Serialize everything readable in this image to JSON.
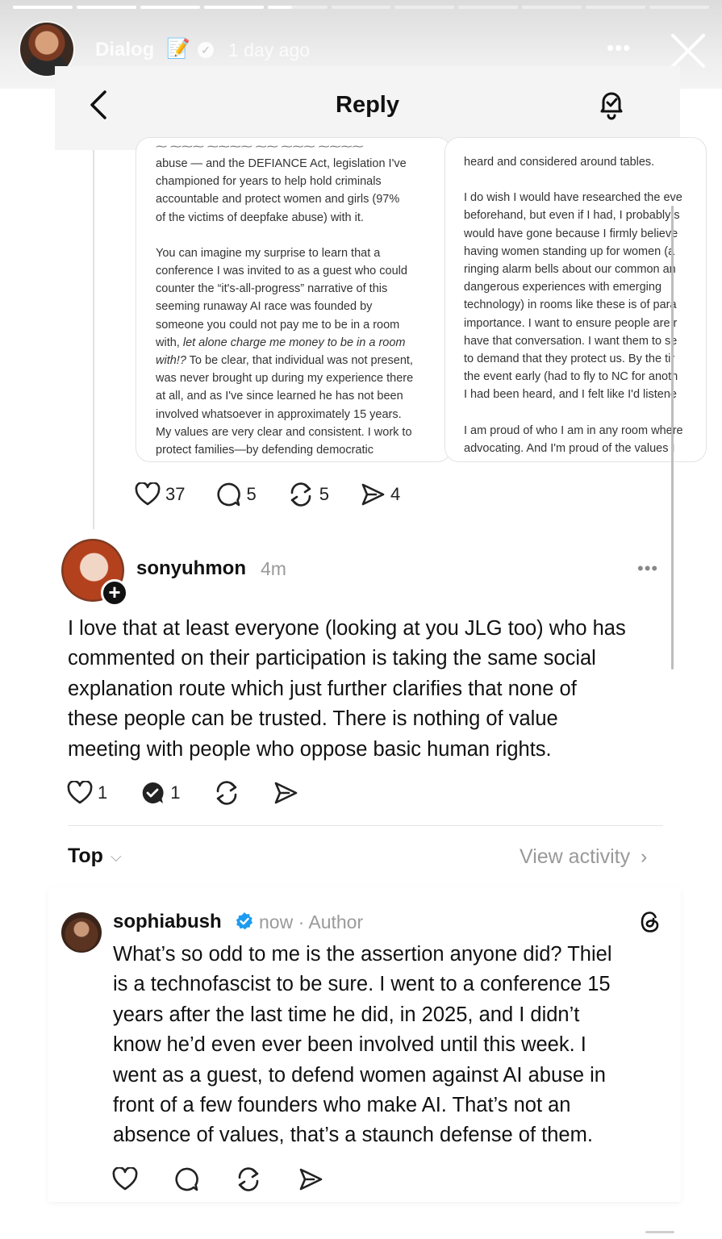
{
  "story": {
    "account": "Dialog",
    "emoji": "📝",
    "time": "1 day ago",
    "more": "•••"
  },
  "header": {
    "title": "Reply"
  },
  "card_left": {
    "lines_a": [
      "abuse — and the DEFIANCE Act, legislation I've",
      "championed for years to help hold criminals",
      "accountable and protect women and girls (97%",
      "of the victims of deepfake abuse) with it."
    ],
    "lines_b_plain": [
      "You can imagine my surprise to learn that a",
      "conference I was invited to as a guest who could",
      "counter the “it's-all-progress” narrative of this",
      "seeming runaway AI race was founded by",
      "someone you could not pay me to be in a room"
    ],
    "italic_line_1_prefix": "with, ",
    "italic_line_1_italic": "let alone charge me money to be in a room",
    "italic_line_2_italic": "with!?",
    "italic_line_2_suffix": " To be clear, that individual was not present,",
    "lines_c": [
      "was never brought up during my experience there",
      "at all, and as I've since learned he has not been",
      "involved whatsoever in approximately 15 years.",
      "My values are very clear and consistent. I work to",
      "protect families—by defending democratic"
    ]
  },
  "card_right": {
    "lines_a": [
      "heard and considered around tables."
    ],
    "lines_b": [
      "I do wish I would have researched the eve",
      "beforehand, but even if I had, I probably s",
      "would have gone because I firmly believe",
      "having women standing up for women (a",
      "ringing alarm bells about our common an",
      "dangerous experiences with emerging",
      "technology) in rooms like these is of para",
      "importance. I want to ensure people are r",
      "have that conversation. I want them to se",
      "to demand that they protect us. By the tir",
      "the event early (had to fly to NC for anoth",
      "I had been heard, and I felt like I'd listene"
    ],
    "lines_c": [
      "I am proud of who I am in any room where",
      "advocating. And I'm proud of the values I"
    ]
  },
  "root_actions": {
    "likes": "37",
    "comments": "5",
    "reposts": "5",
    "shares": "4"
  },
  "comment1": {
    "username": "sonyuhmon",
    "time": "4m",
    "more": "•••",
    "lines": [
      "I love that at least everyone (looking at you JLG too) who has",
      "commented on their participation is taking the same social",
      "explanation route which just further clarifies that none of",
      "these people can be trusted. There is nothing of value",
      "meeting with people who oppose basic human rights."
    ],
    "likes": "1",
    "replies": "1"
  },
  "sort": {
    "label": "Top",
    "view_activity": "View activity"
  },
  "reply": {
    "username": "sophiabush",
    "meta": "now · Author",
    "lines": [
      "What’s so odd to me is the assertion anyone did? Thiel",
      "is a technofascist to be sure. I went to a conference 15",
      "years after the last time he did, in 2025, and I didn’t",
      "know he’d even ever been involved until this week. I",
      "went as a guest, to defend women against AI abuse in",
      "front of a few founders who make AI. That’s not an",
      "absence of values, that’s a staunch defense of them."
    ]
  },
  "colors": {
    "verified": "#1d9bf0",
    "text": "#111111",
    "muted": "#9a9a9a"
  }
}
